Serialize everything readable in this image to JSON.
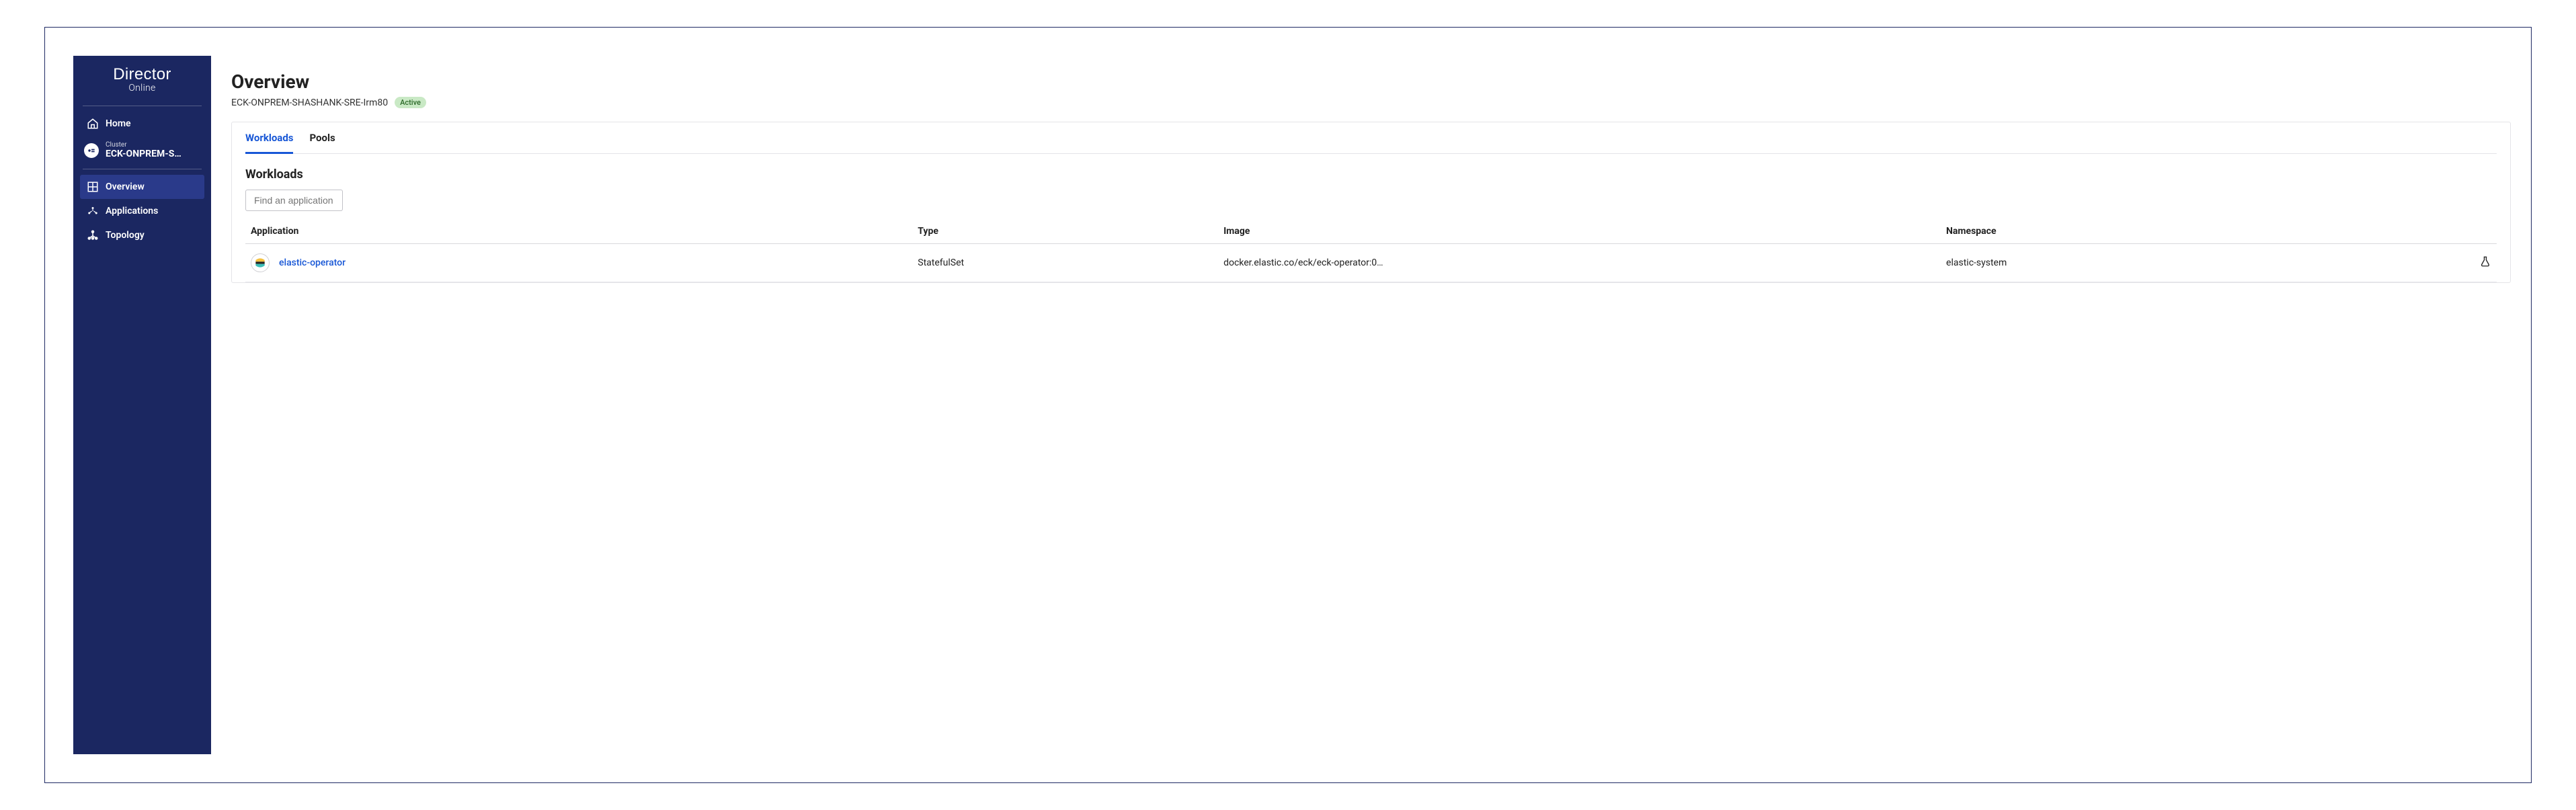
{
  "brand": {
    "title": "Director",
    "subtitle": "Online"
  },
  "sidebar": {
    "home": "Home",
    "cluster": {
      "label": "Cluster",
      "name": "ECK-ONPREM-S…"
    },
    "items": [
      {
        "label": "Overview"
      },
      {
        "label": "Applications"
      },
      {
        "label": "Topology"
      }
    ]
  },
  "page": {
    "title": "Overview",
    "cluster_full": "ECK-ONPREM-SHASHANK-SRE-Irm80",
    "status": "Active"
  },
  "tabs": {
    "workloads": "Workloads",
    "pools": "Pools"
  },
  "section": {
    "title": "Workloads",
    "search_placeholder": "Find an application"
  },
  "table": {
    "headers": {
      "application": "Application",
      "type": "Type",
      "image": "Image",
      "namespace": "Namespace"
    },
    "rows": [
      {
        "name": "elastic-operator",
        "type": "StatefulSet",
        "image": "docker.elastic.co/eck/eck-operator:0…",
        "namespace": "elastic-system"
      }
    ]
  }
}
